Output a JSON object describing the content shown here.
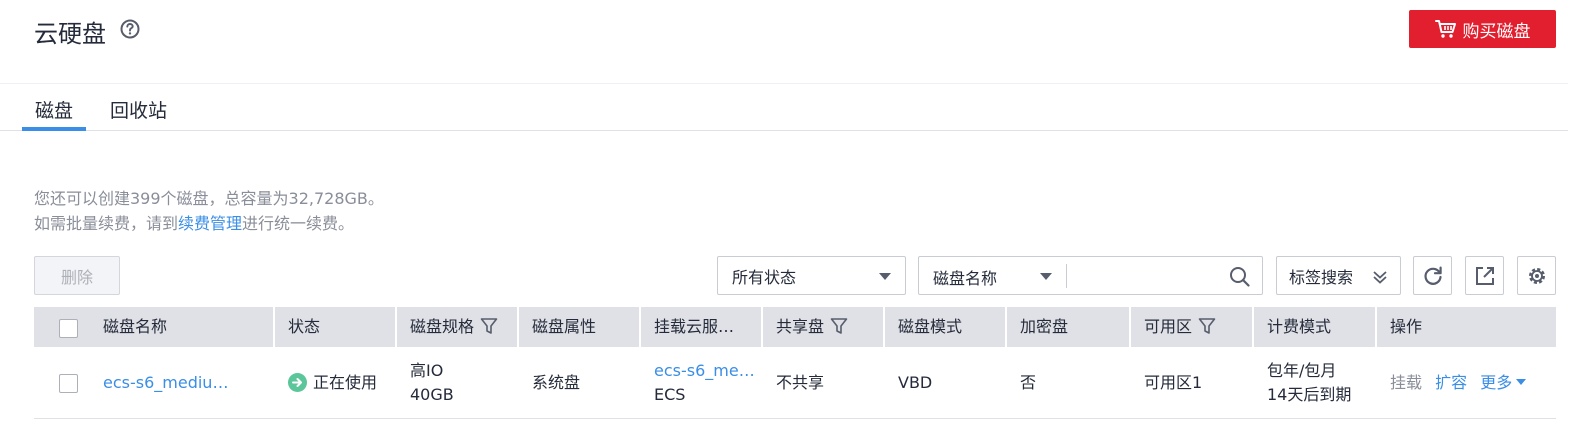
{
  "header": {
    "title": "云硬盘",
    "buy_label": "购买磁盘"
  },
  "tabs": [
    {
      "label": "磁盘",
      "active": true
    },
    {
      "label": "回收站",
      "active": false
    }
  ],
  "info": {
    "line1": "您还可以创建399个磁盘，总容量为32,728GB。",
    "line2_prefix": "如需批量续费，请到",
    "line2_link": "续费管理",
    "line2_suffix": "进行统一续费。"
  },
  "toolbar": {
    "delete_label": "删除",
    "status_select": "所有状态",
    "search_type": "磁盘名称",
    "search_placeholder": "",
    "tag_search_label": "标签搜索"
  },
  "table": {
    "columns": [
      "磁盘名称",
      "状态",
      "磁盘规格",
      "磁盘属性",
      "挂载云服…",
      "共享盘",
      "磁盘模式",
      "加密盘",
      "可用区",
      "计费模式",
      "操作"
    ],
    "rows": [
      {
        "name": "ecs-s6_mediu…",
        "status": "正在使用",
        "spec_type": "高IO",
        "spec_size": "40GB",
        "attribute": "系统盘",
        "server_name": "ecs-s6_me…",
        "server_type": "ECS",
        "shared": "不共享",
        "mode": "VBD",
        "encrypted": "否",
        "zone": "可用区1",
        "billing_type": "包年/包月",
        "billing_expire": "14天后到期",
        "ops": [
          "挂载",
          "扩容",
          "更多"
        ]
      }
    ]
  },
  "colors": {
    "primary_red": "#e21f2e",
    "link_blue": "#3a8ee6",
    "status_green": "#5ac69a",
    "header_gray": "#dfe1e6"
  }
}
